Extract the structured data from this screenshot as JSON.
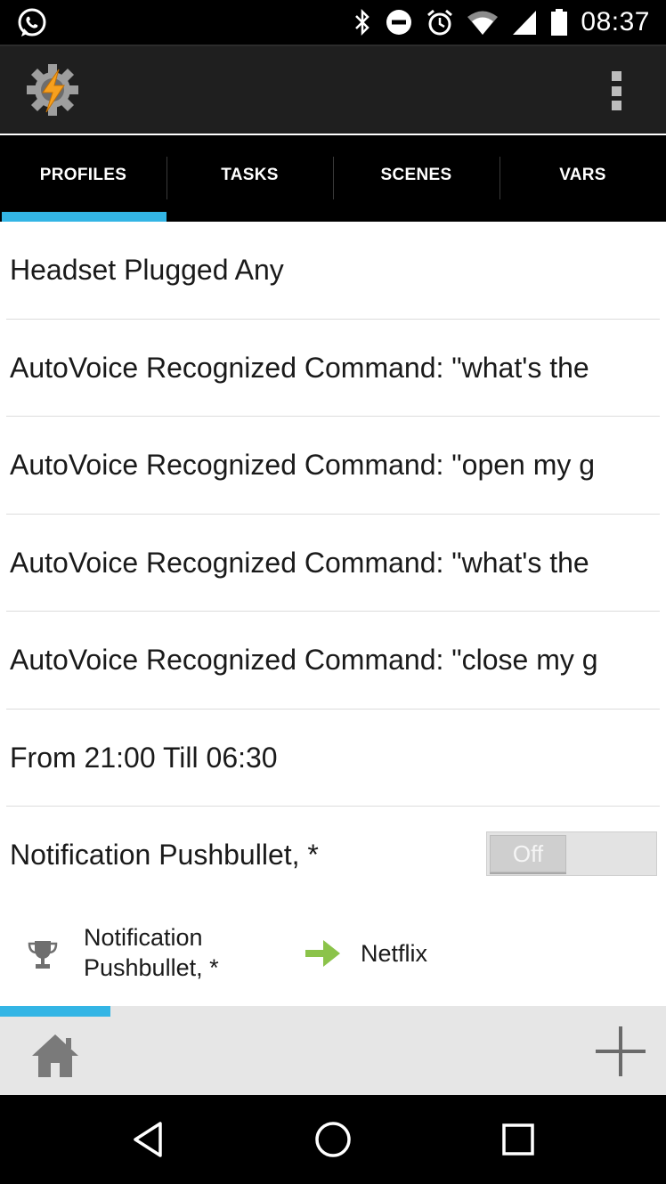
{
  "status_bar": {
    "time": "08:37",
    "icons": [
      "whatsapp-icon",
      "bluetooth-icon",
      "do-not-disturb-icon",
      "alarm-icon",
      "wifi-icon",
      "cell-signal-icon",
      "battery-icon"
    ]
  },
  "action_bar": {
    "logo_icon": "tasker-gear-bolt-icon",
    "overflow_icon": "overflow-menu-icon"
  },
  "tabs": [
    {
      "label": "PROFILES",
      "active": true
    },
    {
      "label": "TASKS",
      "active": false
    },
    {
      "label": "SCENES",
      "active": false
    },
    {
      "label": "VARS",
      "active": false
    }
  ],
  "profiles": [
    {
      "label": "Headset Plugged Any"
    },
    {
      "label": "AutoVoice Recognized Command: \"what's the"
    },
    {
      "label": "AutoVoice Recognized Command: \"open my g"
    },
    {
      "label": "AutoVoice Recognized Command: \"what's the"
    },
    {
      "label": "AutoVoice Recognized Command: \"close my g"
    },
    {
      "label": "From 21:00 Till 06:30"
    },
    {
      "label": "Notification Pushbullet, *",
      "toggle": "Off"
    }
  ],
  "expanded_profile": {
    "context_label": "Notification Pushbullet, *",
    "task_label": "Netflix"
  },
  "bottom_bar": {
    "home_icon": "home-icon",
    "add_icon": "plus-icon"
  },
  "colors": {
    "accent": "#33b5e5",
    "arrow": "#8bc34a"
  }
}
